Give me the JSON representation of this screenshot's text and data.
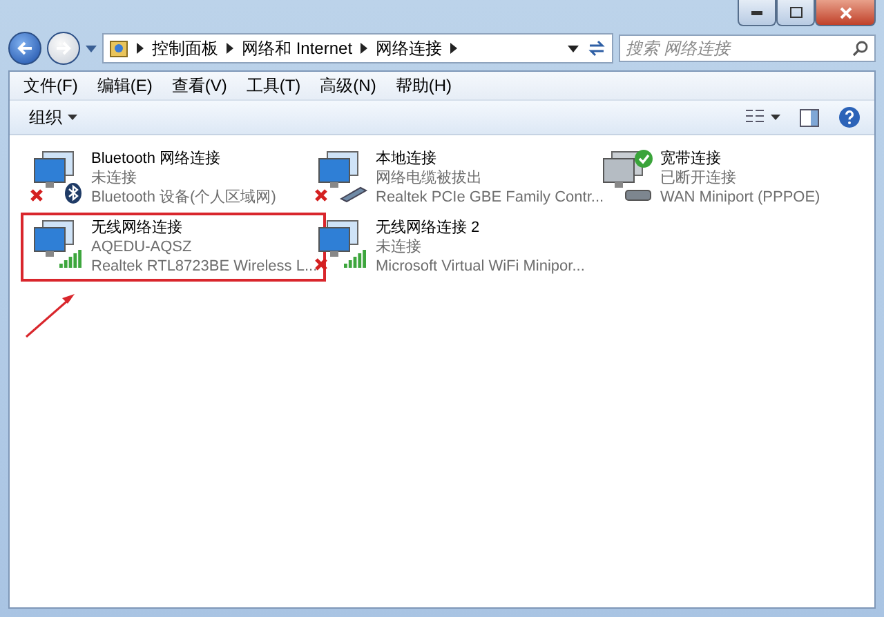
{
  "address_bar": {
    "crumbs": [
      "控制面板",
      "网络和 Internet",
      "网络连接"
    ]
  },
  "search": {
    "placeholder": "搜索 网络连接"
  },
  "menu": [
    "文件(F)",
    "编辑(E)",
    "查看(V)",
    "工具(T)",
    "高级(N)",
    "帮助(H)"
  ],
  "command_bar": {
    "organize": "组织"
  },
  "connections": [
    {
      "name": "Bluetooth 网络连接",
      "status": "未连接",
      "device": "Bluetooth 设备(个人区域网)",
      "kind": "bluetooth",
      "error": true,
      "is_default": false,
      "greyed": false,
      "highlighted": false
    },
    {
      "name": "本地连接",
      "status": "网络电缆被拔出",
      "device": "Realtek PCIe GBE Family Contr...",
      "kind": "ethernet",
      "error": true,
      "is_default": false,
      "greyed": false,
      "highlighted": false
    },
    {
      "name": "宽带连接",
      "status": "已断开连接",
      "device": "WAN Miniport (PPPOE)",
      "kind": "wan",
      "error": false,
      "is_default": true,
      "greyed": true,
      "highlighted": false
    },
    {
      "name": "无线网络连接",
      "status": "AQEDU-AQSZ",
      "device": "Realtek RTL8723BE Wireless L...",
      "kind": "wireless",
      "error": false,
      "is_default": false,
      "greyed": false,
      "highlighted": true
    },
    {
      "name": "无线网络连接 2",
      "status": "未连接",
      "device": "Microsoft Virtual WiFi Minipor...",
      "kind": "wireless",
      "error": true,
      "is_default": false,
      "greyed": false,
      "highlighted": false
    }
  ]
}
